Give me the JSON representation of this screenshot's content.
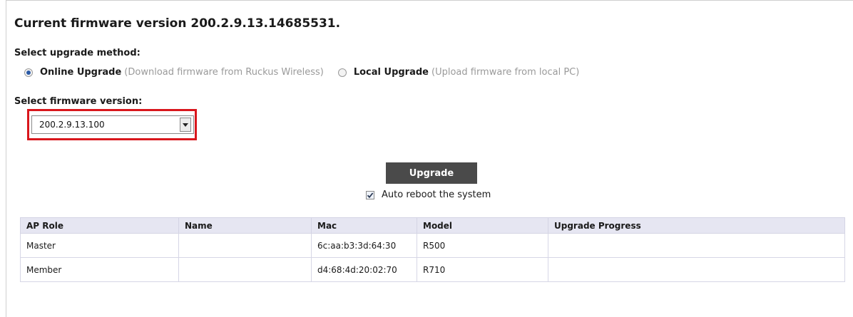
{
  "header": {
    "title": "Current firmware version 200.2.9.13.14685531."
  },
  "upgrade_method": {
    "label": "Select upgrade method:",
    "options": [
      {
        "label": "Online Upgrade",
        "hint": "(Download firmware from Ruckus Wireless)",
        "selected": true
      },
      {
        "label": "Local Upgrade",
        "hint": "(Upload firmware from local PC)",
        "selected": false
      }
    ]
  },
  "firmware": {
    "label": "Select firmware version:",
    "selected": "200.2.9.13.100"
  },
  "actions": {
    "upgrade_label": "Upgrade",
    "auto_reboot_label": "Auto reboot the system",
    "auto_reboot_checked": true
  },
  "table": {
    "columns": [
      "AP Role",
      "Name",
      "Mac",
      "Model",
      "Upgrade Progress"
    ],
    "rows": [
      [
        "Master",
        "",
        "6c:aa:b3:3d:64:30",
        "R500",
        ""
      ],
      [
        "Member",
        "",
        "d4:68:4d:20:02:70",
        "R710",
        ""
      ]
    ]
  },
  "colors": {
    "highlight": "#d9161c",
    "button_bg": "#4a4a4a",
    "table_header_bg": "#e6e6f2",
    "radio_dot": "#2b5aa6",
    "hint_text": "#9a9a9a"
  }
}
